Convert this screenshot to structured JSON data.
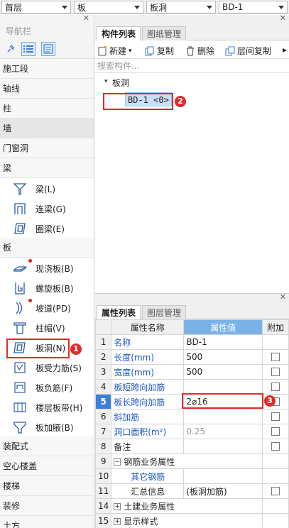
{
  "topbar": {
    "floor": "首层",
    "category": "板",
    "type": "板洞",
    "component": "BD-1"
  },
  "nav": {
    "title": "导航栏",
    "categories_before": [
      "施工段",
      "轴线",
      "柱",
      "墙",
      "门窗洞",
      "梁"
    ],
    "beam_items": [
      {
        "label": "梁(L)",
        "icon": "beam-icon"
      },
      {
        "label": "连梁(G)",
        "icon": "link-beam-icon"
      },
      {
        "label": "圈梁(E)",
        "icon": "ring-beam-icon"
      }
    ],
    "slab_category": "板",
    "slab_items": [
      {
        "label": "现浇板(B)",
        "icon": "cast-slab-icon",
        "dot": true
      },
      {
        "label": "螺旋板(B)",
        "icon": "spiral-slab-icon",
        "dot": false
      },
      {
        "label": "坡道(PD)",
        "icon": "ramp-icon",
        "dot": true
      },
      {
        "label": "柱帽(V)",
        "icon": "column-cap-icon",
        "dot": false
      },
      {
        "label": "板洞(N)",
        "icon": "slab-hole-icon",
        "dot": false
      },
      {
        "label": "板受力筋(S)",
        "icon": "slab-rebar-icon",
        "dot": false
      },
      {
        "label": "板负筋(F)",
        "icon": "neg-rebar-icon",
        "dot": false
      },
      {
        "label": "楼层板带(H)",
        "icon": "slab-band-icon",
        "dot": false
      },
      {
        "label": "板加腋(B)",
        "icon": "haunch-icon",
        "dot": false
      }
    ],
    "categories_after": [
      "装配式",
      "空心楼盖",
      "楼梯",
      "装修",
      "土方"
    ]
  },
  "components": {
    "tab_active": "构件列表",
    "tab_inactive": "图纸管理",
    "new": "新建",
    "copy": "复制",
    "delete": "删除",
    "floor_copy": "层间复制",
    "search_placeholder": "搜索构件...",
    "tree_root": "板洞",
    "tree_child": "BD-1 <0>"
  },
  "properties": {
    "tab_active": "属性列表",
    "tab_inactive": "图层管理",
    "col_name": "属性名称",
    "col_value": "属性值",
    "col_extra": "附加",
    "rows": [
      {
        "num": "1",
        "name": "名称",
        "value": "BD-1",
        "style": "blue",
        "check": false
      },
      {
        "num": "2",
        "name": "长度(mm)",
        "value": "500",
        "style": "blue",
        "check": true
      },
      {
        "num": "3",
        "name": "宽度(mm)",
        "value": "500",
        "style": "blue",
        "check": true
      },
      {
        "num": "4",
        "name": "板短跨向加筋",
        "value": "",
        "style": "blue",
        "check": true
      },
      {
        "num": "5",
        "name": "板长跨向加筋",
        "value": "2⌀16",
        "style": "sel",
        "check": true
      },
      {
        "num": "6",
        "name": "斜加筋",
        "value": "",
        "style": "blue",
        "check": true
      },
      {
        "num": "7",
        "name": "洞口面积(m²)",
        "value": "0.25",
        "style": "blue",
        "check": true
      },
      {
        "num": "8",
        "name": "备注",
        "value": "",
        "style": "plain",
        "check": true
      },
      {
        "num": "9",
        "name": "钢筋业务属性",
        "value": "",
        "style": "group",
        "check": false
      },
      {
        "num": "10",
        "name": "其它钢筋",
        "value": "",
        "style": "sub",
        "check": false
      },
      {
        "num": "11",
        "name": "汇总信息",
        "value": "(板洞加筋)",
        "style": "sub-plain",
        "check": true
      },
      {
        "num": "14",
        "name": "土建业务属性",
        "value": "",
        "style": "group-plus",
        "check": false
      },
      {
        "num": "15",
        "name": "显示样式",
        "value": "",
        "style": "group-plus",
        "check": false
      }
    ]
  },
  "badges": [
    "1",
    "2",
    "3"
  ]
}
